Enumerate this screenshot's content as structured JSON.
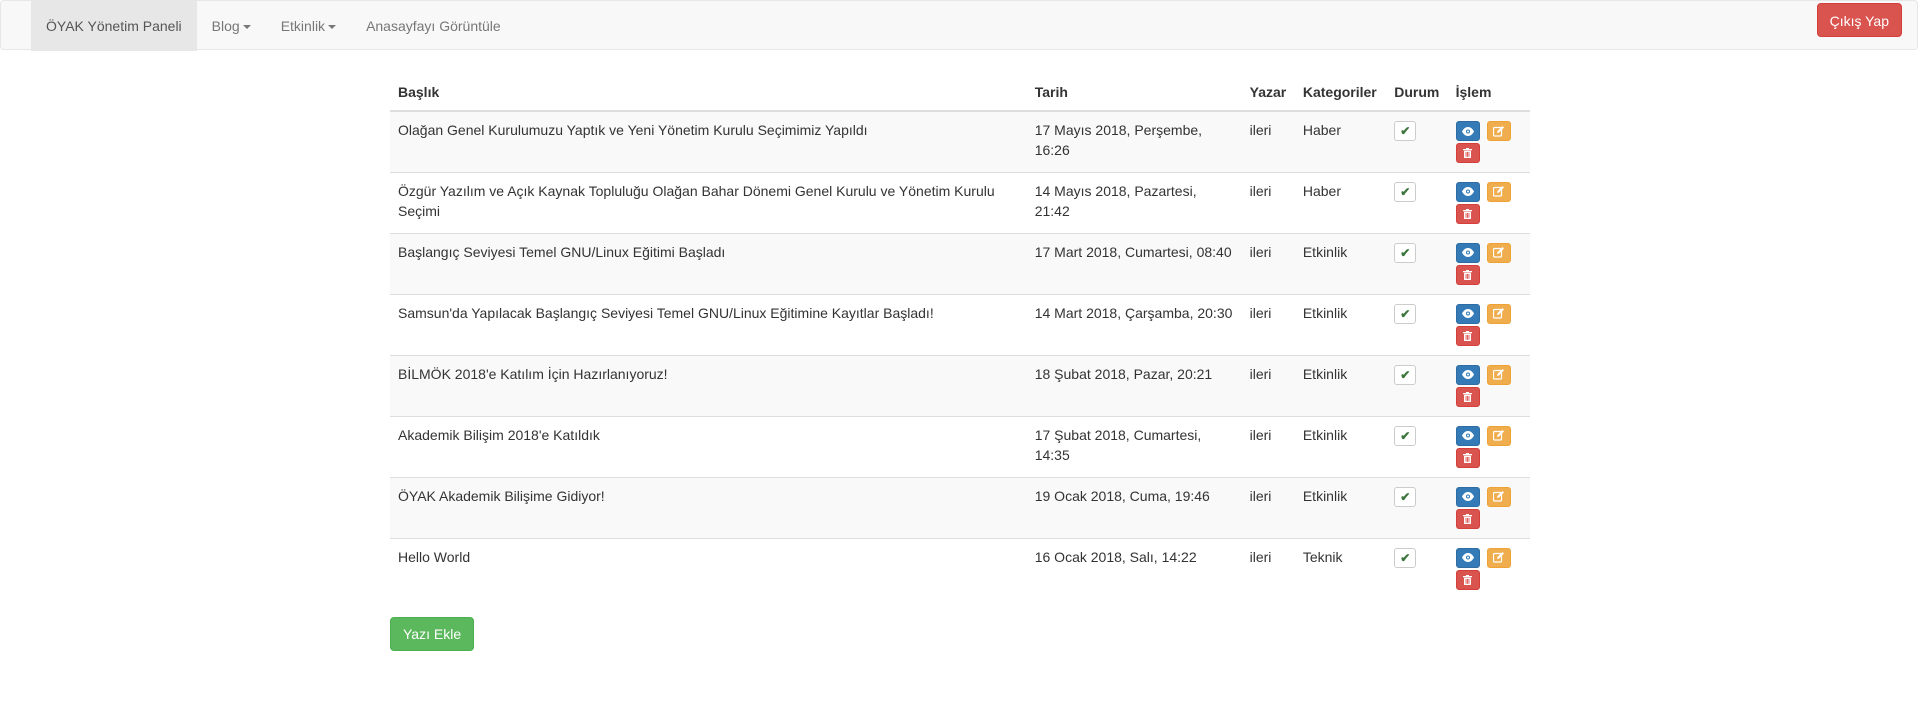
{
  "navbar": {
    "items": [
      {
        "label": "ÖYAK Yönetim Paneli",
        "active": true,
        "dropdown": false
      },
      {
        "label": "Blog",
        "active": false,
        "dropdown": true
      },
      {
        "label": "Etkinlik",
        "active": false,
        "dropdown": true
      },
      {
        "label": "Anasayfayı Görüntüle",
        "active": false,
        "dropdown": false
      }
    ],
    "logout_label": "Çıkış Yap"
  },
  "table": {
    "headers": [
      "Başlık",
      "Tarih",
      "Yazar",
      "Kategoriler",
      "Durum",
      "İşlem"
    ],
    "rows": [
      {
        "title": "Olağan Genel Kurulumuzu Yaptık ve Yeni Yönetim Kurulu Seçimimiz Yapıldı",
        "date": "17 Mayıs 2018, Perşembe, 16:26",
        "author": "ileri",
        "category": "Haber",
        "status": "published"
      },
      {
        "title": "Özgür Yazılım ve Açık Kaynak Topluluğu Olağan Bahar Dönemi Genel Kurulu ve Yönetim Kurulu Seçimi",
        "date": "14 Mayıs 2018, Pazartesi, 21:42",
        "author": "ileri",
        "category": "Haber",
        "status": "published"
      },
      {
        "title": "Başlangıç Seviyesi Temel GNU/Linux Eğitimi Başladı",
        "date": "17 Mart 2018, Cumartesi, 08:40",
        "author": "ileri",
        "category": "Etkinlik",
        "status": "published"
      },
      {
        "title": "Samsun'da Yapılacak Başlangıç Seviyesi Temel GNU/Linux Eğitimine Kayıtlar Başladı!",
        "date": "14 Mart 2018, Çarşamba, 20:30",
        "author": "ileri",
        "category": "Etkinlik",
        "status": "published"
      },
      {
        "title": "BİLMÖK 2018'e Katılım İçin Hazırlanıyoruz!",
        "date": "18 Şubat 2018, Pazar, 20:21",
        "author": "ileri",
        "category": "Etkinlik",
        "status": "published"
      },
      {
        "title": "Akademik Bilişim 2018'e Katıldık",
        "date": "17 Şubat 2018, Cumartesi, 14:35",
        "author": "ileri",
        "category": "Etkinlik",
        "status": "published"
      },
      {
        "title": "ÖYAK Akademik Bilişime Gidiyor!",
        "date": "19 Ocak 2018, Cuma, 19:46",
        "author": "ileri",
        "category": "Etkinlik",
        "status": "published"
      },
      {
        "title": "Hello World",
        "date": "16 Ocak 2018, Salı, 14:22",
        "author": "ileri",
        "category": "Teknik",
        "status": "published"
      }
    ]
  },
  "add_post_label": "Yazı Ekle",
  "icons": {
    "status": "check-icon",
    "view": "eye-icon",
    "edit": "edit-icon",
    "delete": "trash-icon"
  },
  "colors": {
    "primary": "#337ab7",
    "warning": "#f0ad4e",
    "danger": "#d9534f",
    "success": "#5cb85c"
  }
}
